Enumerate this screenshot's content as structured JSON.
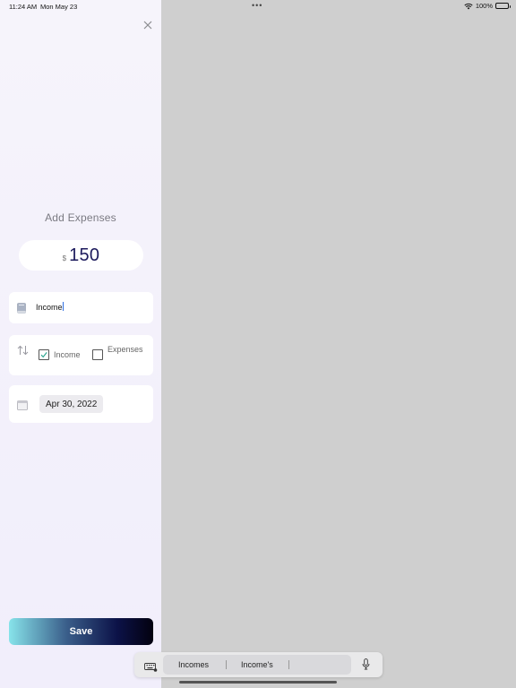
{
  "status_bar": {
    "time": "11:24 AM",
    "date": "Mon May 23",
    "dots": "•••",
    "battery_label": "100%"
  },
  "form": {
    "title": "Add Expenses",
    "currency": "$",
    "amount": "150",
    "name_value": "Income",
    "type_options": {
      "income_label": "Income",
      "income_checked": true,
      "expense_label": "Expenses",
      "expense_checked": false
    },
    "date_value": "Apr 30, 2022",
    "save_label": "Save"
  },
  "keyboard_bar": {
    "suggestions": [
      "Incomes",
      "Income's"
    ]
  },
  "colors": {
    "panel_bg": "#f3f1fb",
    "overlay_bg": "#cfcfcf",
    "amount_text": "#1c1a5c",
    "check_mark": "#2aa58f",
    "caret": "#2f6fe0"
  },
  "icons": {
    "close": "close-icon",
    "name_field": "book-icon",
    "type_field": "swap-arrows-icon",
    "date_field": "calendar-icon",
    "keyboard": "keyboard-icon",
    "mic": "microphone-icon",
    "wifi": "wifi-icon",
    "battery": "battery-icon"
  }
}
